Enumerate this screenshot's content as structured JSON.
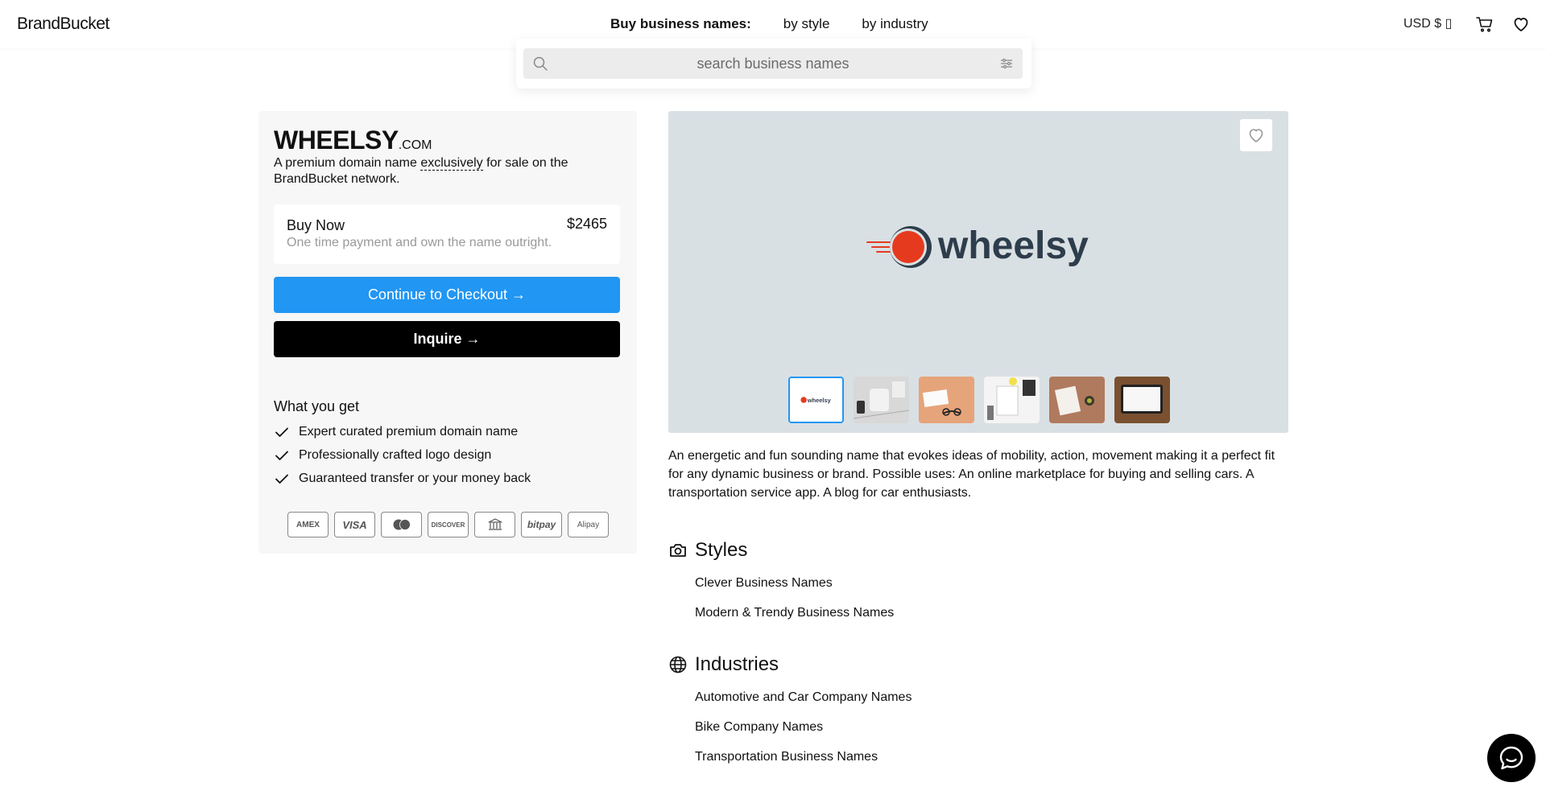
{
  "header": {
    "logo": "BrandBucket",
    "nav_title": "Buy business names:",
    "nav_items": [
      "by style",
      "by industry"
    ],
    "currency": "USD $ ▯"
  },
  "search": {
    "placeholder": "search business names"
  },
  "domain": {
    "name": "WHEELSY",
    "tld": ".COM",
    "desc_prefix": "A premium domain name ",
    "desc_emphasis": "exclusively",
    "desc_suffix": " for sale on the BrandBucket network."
  },
  "buy": {
    "title": "Buy Now",
    "subtitle": "One time payment and own the name outright.",
    "price": "$2465",
    "checkout_label": "Continue to Checkout →",
    "inquire_label": "Inquire →"
  },
  "what_you_get": {
    "title": "What you get",
    "items": [
      "Expert curated premium domain name",
      "Professionally crafted logo design",
      "Guaranteed transfer or your money back"
    ]
  },
  "payments": [
    "AMEX",
    "VISA",
    "mastercard",
    "DISCOVER",
    "bank",
    "bitpay",
    "Alipay"
  ],
  "gallery": {
    "logo_text": "wheelsy",
    "thumb_logo_text": "wheelsy",
    "active_index": 0
  },
  "description": "An energetic and fun sounding name that evokes ideas of mobility, action, movement making it a perfect fit for any dynamic business or brand. Possible uses: An online marketplace for buying and selling cars. A transportation service app. A blog for car enthusiasts.",
  "styles": {
    "title": "Styles",
    "items": [
      "Clever Business Names",
      "Modern & Trendy Business Names"
    ]
  },
  "industries": {
    "title": "Industries",
    "items": [
      "Automotive and Car Company Names",
      "Bike Company Names",
      "Transportation Business Names"
    ]
  },
  "colors": {
    "accent": "#2196f3",
    "logo_red": "#e63a1e",
    "logo_navy": "#2e3d4b",
    "gallery_bg": "#d9e0e4"
  }
}
